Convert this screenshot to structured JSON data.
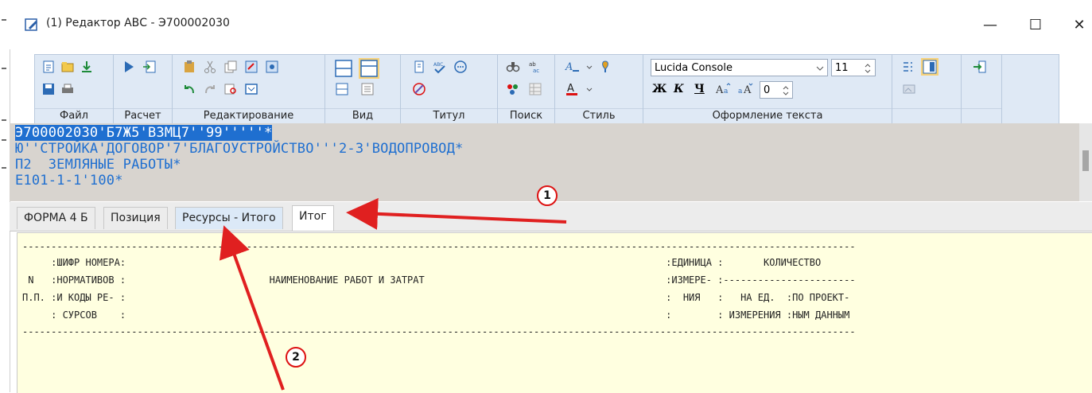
{
  "window": {
    "title": "(1) Редактор АВС - Э700002030",
    "minimize_glyph": "—",
    "maximize_glyph": "☐",
    "close_glyph": "✕"
  },
  "ribbon": {
    "groups": [
      "Файл",
      "Расчет",
      "Редактирование",
      "Вид",
      "Титул",
      "Поиск",
      "Стиль",
      "Оформление текста"
    ],
    "font_name": "Lucida Console",
    "font_size": "11",
    "spacing_value": "0",
    "bold_label": "Ж",
    "italic_label": "К",
    "underline_label": "Ч"
  },
  "editor": {
    "lines": [
      "Э700002030'Б7Ж5'ВЗМЦ7''99'''''*",
      "Ю''СТРОЙКА'ДОГОВОР'7'БЛАГОУСТРОЙСТВО'''2-3'ВОДОПРОВОД*",
      "П2  ЗЕМЛЯНЫЕ РАБОТЫ*",
      "Е101-1-1'100*"
    ]
  },
  "tabs": [
    "ФОРМА 4 Б",
    "Позиция",
    "Ресурсы - Итого",
    "Итог"
  ],
  "report": {
    "lines": [
      "-------------------------------------------------------------------------------------------------------------------------------------------------",
      "     :ШИФР НОМЕРА:                                                                                              :ЕДИНИЦА :       КОЛИЧЕСТВО",
      " N   :НОРМАТИВОВ :                         НАИМЕНОВАНИЕ РАБОТ И ЗАТРАТ                                          :ИЗМЕРЕ- :-----------------------",
      "П.П. :И КОДЫ РЕ- :                                                                                              :  НИЯ   :   НА ЕД.  :ПО ПРОЕКТ-",
      "     : СУРСОВ    :                                                                                              :        : ИЗМЕРЕНИЯ :НЫМ ДАННЫМ",
      "-------------------------------------------------------------------------------------------------------------------------------------------------"
    ]
  },
  "annotations": {
    "badge1": "1",
    "badge2": "2",
    "arrow_color": "#e02020"
  }
}
